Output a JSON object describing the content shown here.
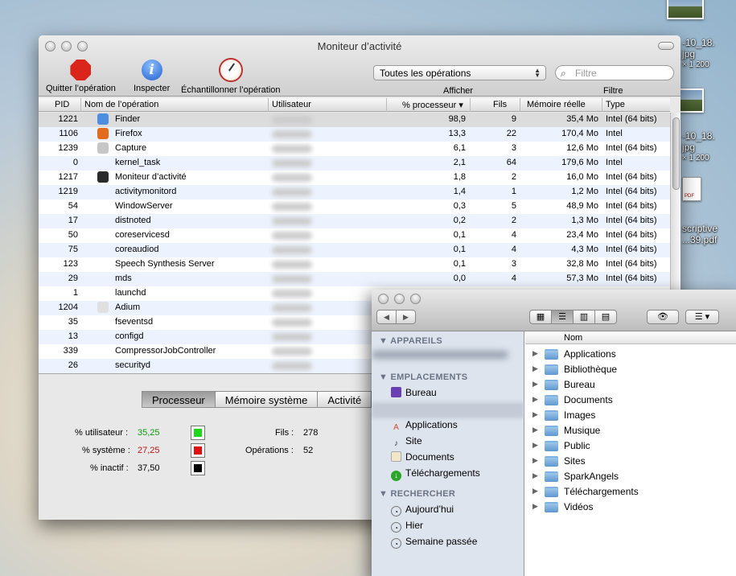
{
  "desktop": {
    "files": [
      {
        "name_line1": "-10_18.",
        "name_line2": "jpg",
        "size": "× 1 200"
      },
      {
        "name_line1": "-10_18.",
        "name_line2": "jpg",
        "size": "× 1 200"
      },
      {
        "name_line1": "scriptive",
        "name_line2": "...39.pdf"
      }
    ],
    "pdf_badge": "PDF",
    "st_text": "st"
  },
  "activity_monitor": {
    "title": "Moniteur d’activité",
    "toolbar": {
      "quit": "Quitter l’opération",
      "inspect": "Inspecter",
      "sample": "Échantillonner l’opération",
      "filter_select": "Toutes les opérations",
      "show_label": "Afficher",
      "search_placeholder": "Filtre",
      "filter_label": "Filtre"
    },
    "columns": {
      "pid": "PID",
      "name": "Nom de l’opération",
      "user": "Utilisateur",
      "cpu": "% processeur",
      "threads": "Fils",
      "mem": "Mémoire réelle",
      "type": "Type"
    },
    "processes": [
      {
        "pid": "1221",
        "name": "Finder",
        "cpu": "98,9",
        "threads": "9",
        "mem": "35,4 Mo",
        "type": "Intel (64 bits)",
        "icon": "finder-icon",
        "color": "#4d8ee0"
      },
      {
        "pid": "1106",
        "name": "Firefox",
        "cpu": "13,3",
        "threads": "22",
        "mem": "170,4 Mo",
        "type": "Intel",
        "icon": "firefox-icon",
        "color": "#e46b1c"
      },
      {
        "pid": "1239",
        "name": "Capture",
        "cpu": "6,1",
        "threads": "3",
        "mem": "12,6 Mo",
        "type": "Intel (64 bits)",
        "icon": "capture-icon",
        "color": "#c6c6c6"
      },
      {
        "pid": "0",
        "name": "kernel_task",
        "cpu": "2,1",
        "threads": "64",
        "mem": "179,6 Mo",
        "type": "Intel",
        "icon": "",
        "color": ""
      },
      {
        "pid": "1217",
        "name": "Moniteur d’activité",
        "cpu": "1,8",
        "threads": "2",
        "mem": "16,0 Mo",
        "type": "Intel (64 bits)",
        "icon": "activity-monitor-icon",
        "color": "#2b2b2b"
      },
      {
        "pid": "1219",
        "name": "activitymonitord",
        "cpu": "1,4",
        "threads": "1",
        "mem": "1,2 Mo",
        "type": "Intel (64 bits)",
        "icon": "",
        "color": ""
      },
      {
        "pid": "54",
        "name": "WindowServer",
        "cpu": "0,3",
        "threads": "5",
        "mem": "48,9 Mo",
        "type": "Intel (64 bits)",
        "icon": "",
        "color": ""
      },
      {
        "pid": "17",
        "name": "distnoted",
        "cpu": "0,2",
        "threads": "2",
        "mem": "1,3 Mo",
        "type": "Intel (64 bits)",
        "icon": "",
        "color": ""
      },
      {
        "pid": "50",
        "name": "coreservicesd",
        "cpu": "0,1",
        "threads": "4",
        "mem": "23,4 Mo",
        "type": "Intel (64 bits)",
        "icon": "",
        "color": ""
      },
      {
        "pid": "75",
        "name": "coreaudiod",
        "cpu": "0,1",
        "threads": "4",
        "mem": "4,3 Mo",
        "type": "Intel (64 bits)",
        "icon": "",
        "color": ""
      },
      {
        "pid": "123",
        "name": "Speech Synthesis Server",
        "cpu": "0,1",
        "threads": "3",
        "mem": "32,8 Mo",
        "type": "Intel (64 bits)",
        "icon": "",
        "color": ""
      },
      {
        "pid": "29",
        "name": "mds",
        "cpu": "0,0",
        "threads": "4",
        "mem": "57,3 Mo",
        "type": "Intel (64 bits)",
        "icon": "",
        "color": ""
      },
      {
        "pid": "1",
        "name": "launchd",
        "cpu": "",
        "threads": "",
        "mem": "",
        "type": "",
        "icon": "",
        "color": ""
      },
      {
        "pid": "1204",
        "name": "Adium",
        "cpu": "",
        "threads": "",
        "mem": "",
        "type": "",
        "icon": "adium-icon",
        "color": "#e0e0e0"
      },
      {
        "pid": "35",
        "name": "fseventsd",
        "cpu": "",
        "threads": "",
        "mem": "",
        "type": "",
        "icon": "",
        "color": ""
      },
      {
        "pid": "13",
        "name": "configd",
        "cpu": "",
        "threads": "",
        "mem": "",
        "type": "",
        "icon": "",
        "color": ""
      },
      {
        "pid": "339",
        "name": "CompressorJobController",
        "cpu": "",
        "threads": "",
        "mem": "",
        "type": "",
        "icon": "",
        "color": ""
      },
      {
        "pid": "26",
        "name": "securityd",
        "cpu": "",
        "threads": "",
        "mem": "",
        "type": "",
        "icon": "",
        "color": ""
      }
    ],
    "tabs": [
      "Processeur",
      "Mémoire système",
      "Activité"
    ],
    "stats": {
      "user_label": "% utilisateur :",
      "user_value": "35,25",
      "user_color": "#0e9c0e",
      "user_swatch": "#1ed81e",
      "system_label": "% système :",
      "system_value": "27,25",
      "system_color": "#c01515",
      "system_swatch": "#e01010",
      "idle_label": "% inactif :",
      "idle_value": "37,50",
      "idle_swatch": "#000000",
      "threads_label": "Fils :",
      "threads_value": "278",
      "ops_label": "Opérations :",
      "ops_value": "52"
    }
  },
  "finder": {
    "sidebar": {
      "devices_header": "APPAREILS",
      "places_header": "EMPLACEMENTS",
      "places": [
        {
          "label": "Bureau",
          "icon": "desktop-icon",
          "color": "#6a3fb1"
        },
        {
          "label": "Applications",
          "icon": "applications-icon",
          "color": "#e04a2a"
        },
        {
          "label": "Site",
          "icon": "site-icon",
          "color": "#444"
        },
        {
          "label": "Documents",
          "icon": "documents-icon",
          "color": "#f1e7c8"
        },
        {
          "label": "Téléchargements",
          "icon": "downloads-icon",
          "color": "#2aa52a"
        }
      ],
      "search_header": "RECHERCHER",
      "searches": [
        "Aujourd’hui",
        "Hier",
        "Semaine passée"
      ]
    },
    "column_header": "Nom",
    "items": [
      "Applications",
      "Bibliothèque",
      "Bureau",
      "Documents",
      "Images",
      "Musique",
      "Public",
      "Sites",
      "SparkAngels",
      "Téléchargements",
      "Vidéos"
    ]
  }
}
